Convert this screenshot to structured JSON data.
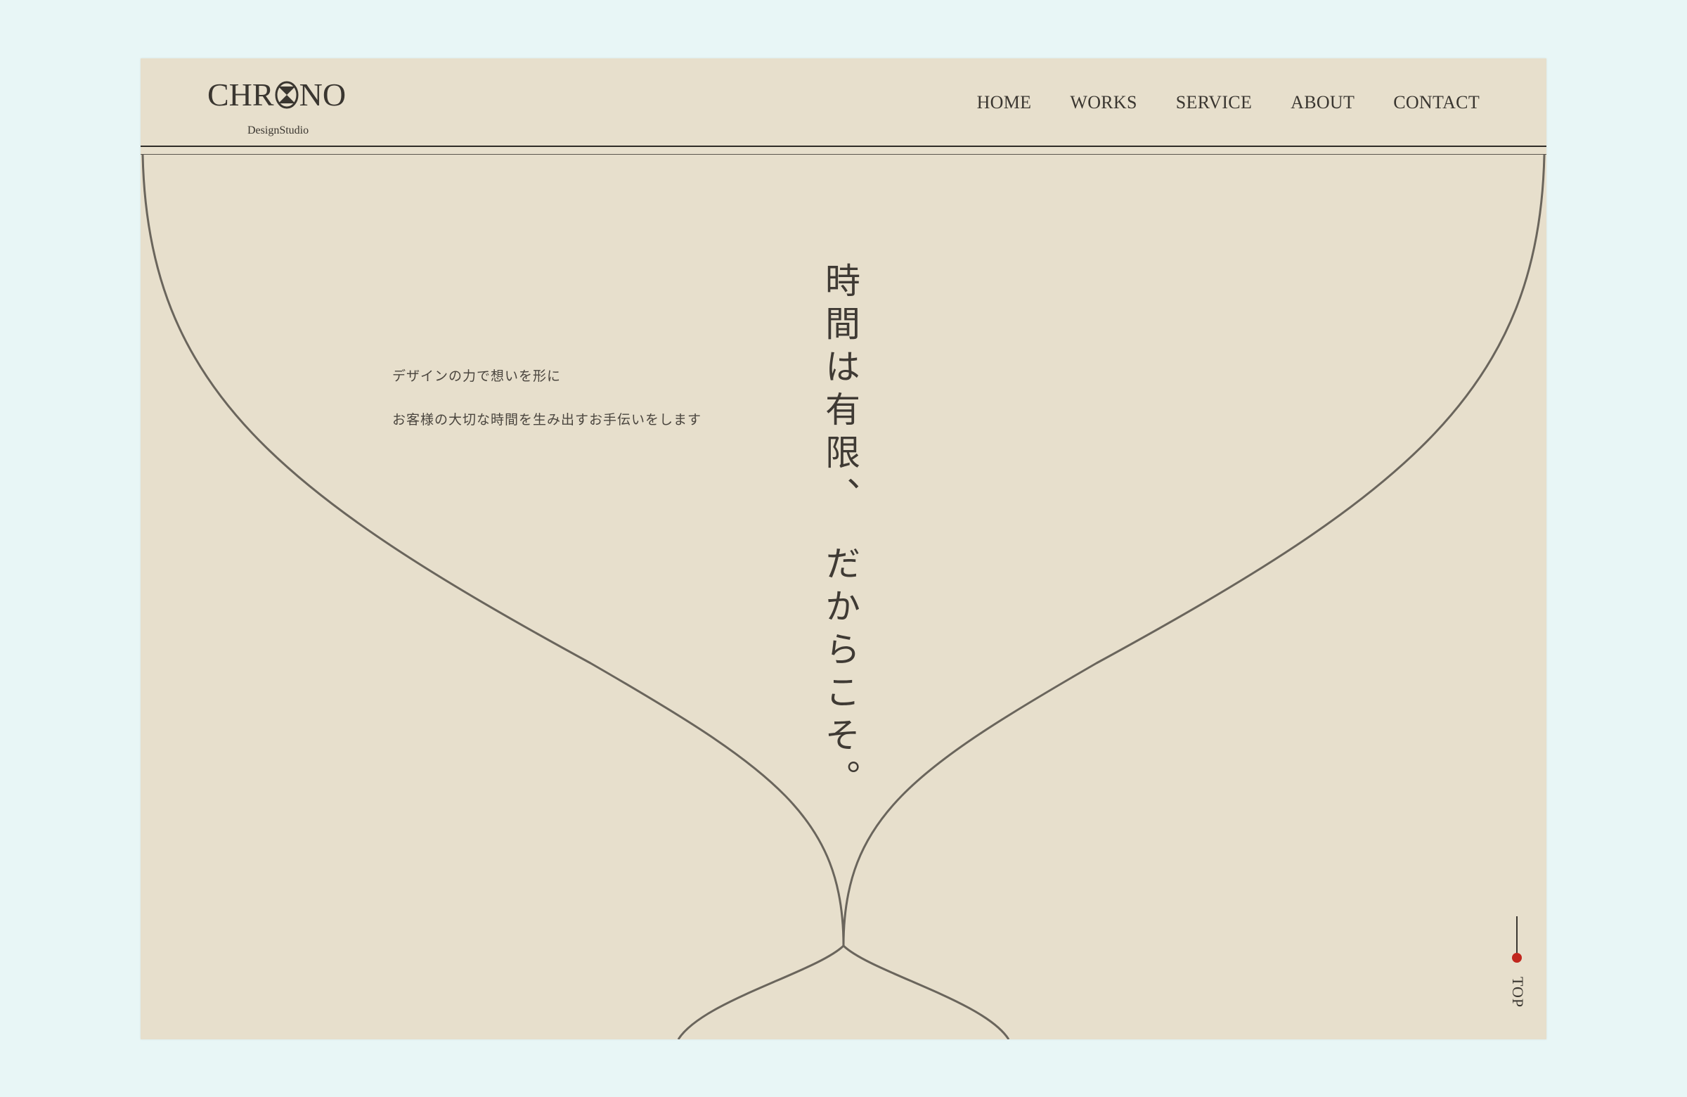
{
  "brand": {
    "name_prefix": "CHR",
    "name_suffix": "NO",
    "subtitle": "DesignStudio"
  },
  "nav": {
    "items": [
      {
        "label": "HOME"
      },
      {
        "label": "WORKS"
      },
      {
        "label": "SERVICE"
      },
      {
        "label": "ABOUT"
      },
      {
        "label": "CONTACT"
      }
    ]
  },
  "hero": {
    "lead_line_1": "デザインの力で想いを形に",
    "lead_line_2": "お客様の大切な時間を生み出すお手伝いをします",
    "tagline": "時間は有限、　だからこそ。",
    "hourglass_icon": "hourglass-icon"
  },
  "to_top": {
    "label": "TOP",
    "dot_color": "#c1271e"
  },
  "colors": {
    "page_background": "#e8f6f6",
    "paper": "#e7dfcc",
    "ink": "#3a3630",
    "accent": "#c1271e"
  }
}
